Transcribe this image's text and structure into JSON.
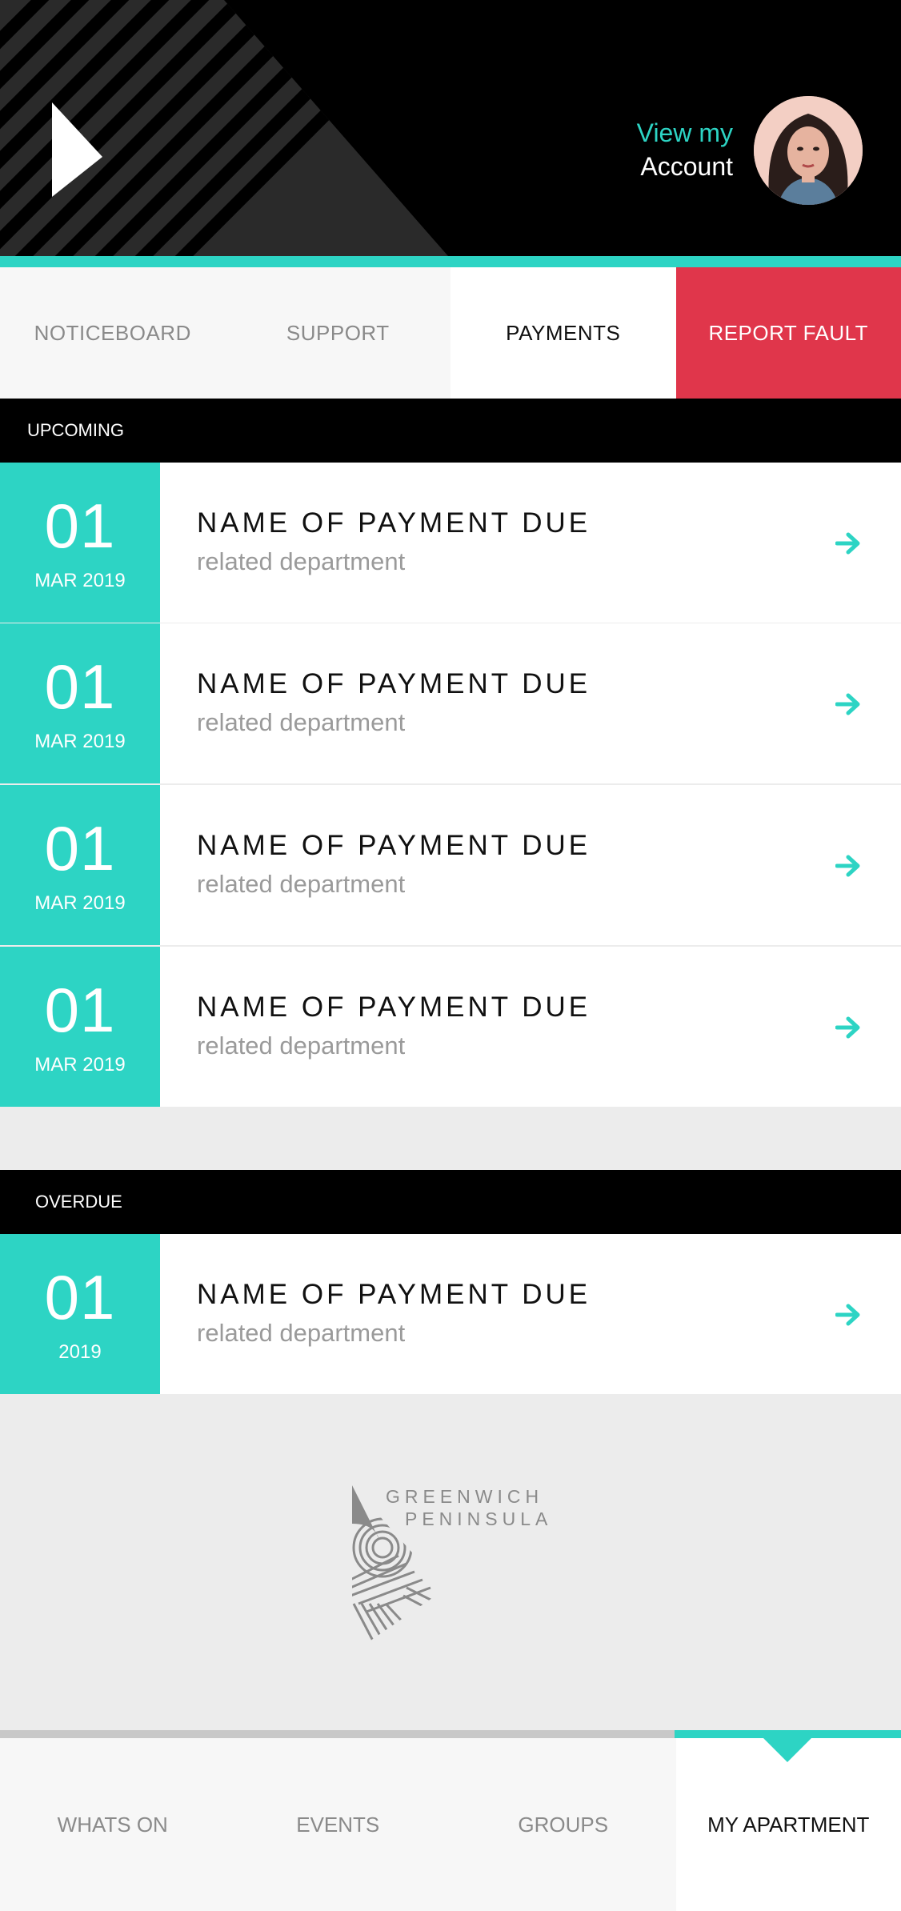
{
  "header": {
    "account_line1": "View my",
    "account_line2": "Account"
  },
  "tabs": [
    {
      "label": "NOTICEBOARD"
    },
    {
      "label": "SUPPORT"
    },
    {
      "label": "PAYMENTS"
    },
    {
      "label": "REPORT FAULT"
    }
  ],
  "upcoming": {
    "label": "UPCOMING",
    "items": [
      {
        "day": "01",
        "month": "MAR 2019",
        "title": "NAME OF PAYMENT DUE",
        "subtitle": "related department"
      },
      {
        "day": "01",
        "month": "MAR 2019",
        "title": "NAME OF PAYMENT DUE",
        "subtitle": "related department"
      },
      {
        "day": "01",
        "month": "MAR 2019",
        "title": "NAME OF PAYMENT DUE",
        "subtitle": "related department"
      },
      {
        "day": "01",
        "month": "MAR 2019",
        "title": "NAME OF PAYMENT DUE",
        "subtitle": "related department"
      }
    ]
  },
  "overdue": {
    "label": "OVERDUE",
    "items": [
      {
        "day": "01",
        "month": "2019",
        "title": "NAME OF PAYMENT DUE",
        "subtitle": "related department"
      }
    ]
  },
  "logo": {
    "line1": "GREENWICH",
    "line2": "PENINSULA"
  },
  "bottom_nav": [
    {
      "label": "WHATS ON"
    },
    {
      "label": "EVENTS"
    },
    {
      "label": "GROUPS"
    },
    {
      "label": "MY APARTMENT"
    }
  ],
  "colors": {
    "accent": "#2dd4c4",
    "fault": "#e0364b",
    "header_bg": "#000000"
  }
}
